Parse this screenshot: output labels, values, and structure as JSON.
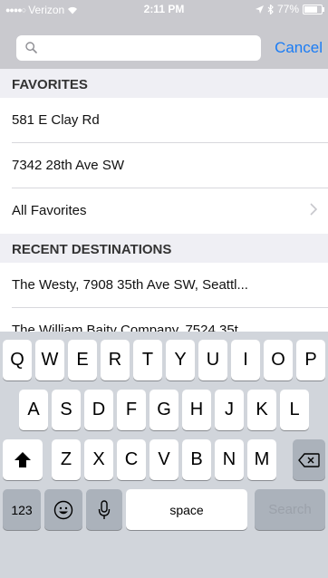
{
  "status_bar": {
    "carrier": "Verizon",
    "time": "2:11 PM",
    "battery": "77%"
  },
  "search": {
    "placeholder": "",
    "value": "",
    "cancel_label": "Cancel"
  },
  "favorites": {
    "header": "FAVORITES",
    "items": [
      {
        "label": "581 E Clay Rd"
      },
      {
        "label": "7342 28th Ave SW"
      },
      {
        "label": "All Favorites"
      }
    ]
  },
  "recents": {
    "header": "RECENT DESTINATIONS",
    "items": [
      {
        "label": "The Westy, 7908 35th Ave SW, Seattl..."
      },
      {
        "label": "The William Baity Company, 7524 35t..."
      }
    ]
  },
  "keyboard": {
    "row1": [
      "Q",
      "W",
      "E",
      "R",
      "T",
      "Y",
      "U",
      "I",
      "O",
      "P"
    ],
    "row2": [
      "A",
      "S",
      "D",
      "F",
      "G",
      "H",
      "J",
      "K",
      "L"
    ],
    "row3": [
      "Z",
      "X",
      "C",
      "V",
      "B",
      "N",
      "M"
    ],
    "numbers_label": "123",
    "space_label": "space",
    "search_label": "Search"
  }
}
